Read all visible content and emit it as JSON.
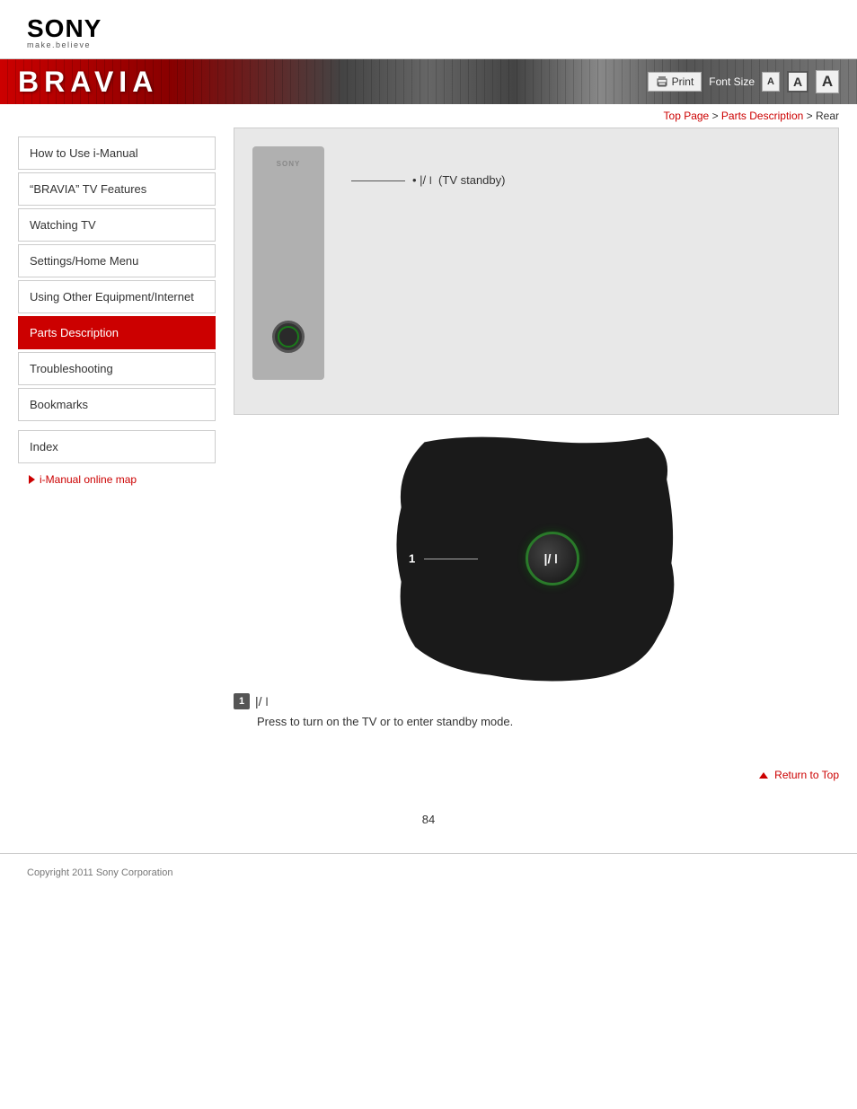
{
  "header": {
    "sony_text": "SONY",
    "sony_tagline": "make.believe",
    "bravia_title": "BRAVIA",
    "print_label": "Print",
    "font_size_label": "Font Size",
    "font_small": "A",
    "font_medium": "A",
    "font_large": "A"
  },
  "breadcrumb": {
    "top_page": "Top Page",
    "separator1": " > ",
    "parts_description": "Parts Description",
    "separator2": " > ",
    "current": "Rear"
  },
  "sidebar": {
    "items": [
      {
        "id": "how-to-use",
        "label": "How to Use i-Manual",
        "active": false
      },
      {
        "id": "bravia-features",
        "label": "“BRAVIA” TV Features",
        "active": false
      },
      {
        "id": "watching-tv",
        "label": "Watching TV",
        "active": false
      },
      {
        "id": "settings-home",
        "label": "Settings/Home Menu",
        "active": false
      },
      {
        "id": "using-other",
        "label": "Using Other Equipment/Internet",
        "active": false
      },
      {
        "id": "parts-description",
        "label": "Parts Description",
        "active": true
      },
      {
        "id": "troubleshooting",
        "label": "Troubleshooting",
        "active": false
      },
      {
        "id": "bookmarks",
        "label": "Bookmarks",
        "active": false
      }
    ],
    "index_label": "Index",
    "online_map_label": "i-Manual online map"
  },
  "diagram": {
    "sony_label": "SONY",
    "callout_label": "• |/⏽ (TV standby)"
  },
  "detail": {
    "callout_number": "1",
    "power_symbol": "|/⏽",
    "desc_number": "1",
    "desc_power_symbol": "|/⏽",
    "desc_text": "Press to turn on the TV or to enter standby mode."
  },
  "return_top": {
    "label": "Return to Top"
  },
  "footer": {
    "copyright": "Copyright 2011 Sony Corporation"
  },
  "page": {
    "number": "84"
  }
}
